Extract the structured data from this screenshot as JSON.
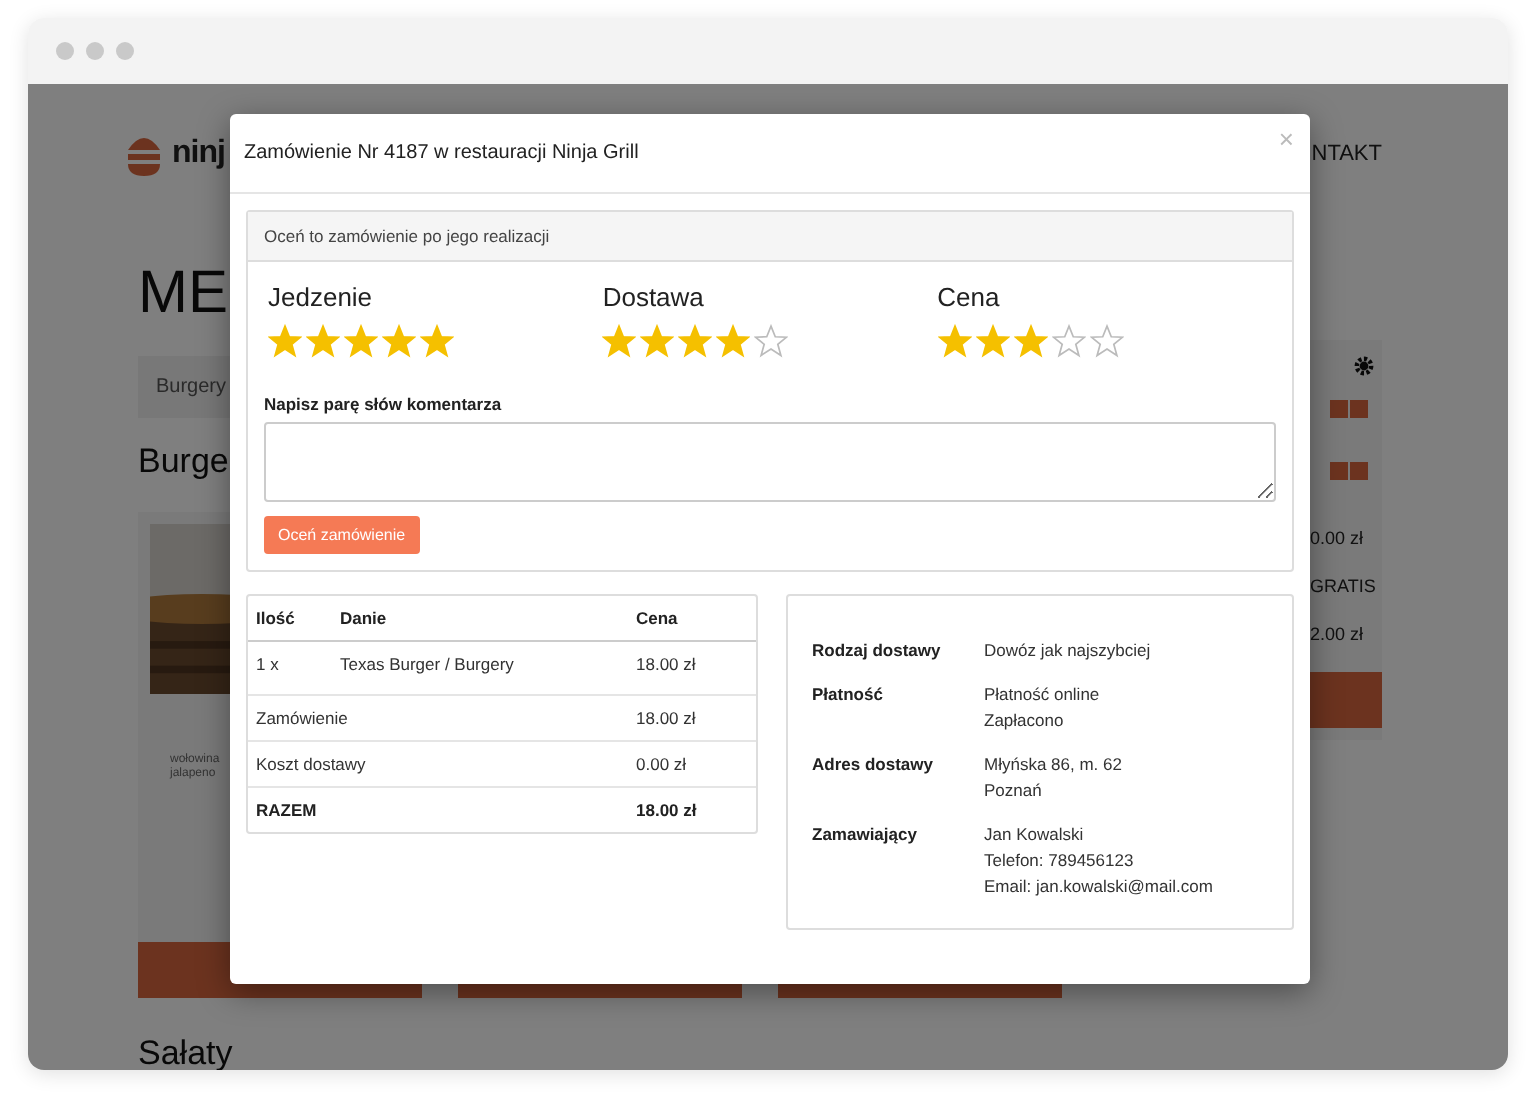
{
  "background_page": {
    "logo_text": "ninj",
    "nav_item": "NTAKT",
    "heading": "ME",
    "breadcrumb": "Burgery",
    "section_title": "Burge",
    "card_texts": [
      "wołowina",
      "jalapeno"
    ],
    "cart_rows": [
      "0.00 zł",
      "GRATIS",
      "2.00 zł"
    ],
    "next_section_title": "Sałaty"
  },
  "modal": {
    "title": "Zamówienie Nr 4187 w restauracji Ninja Grill",
    "close": "×",
    "rating": {
      "header": "Oceń to zamówienie po jego realizacji",
      "categories": [
        {
          "label": "Jedzenie",
          "stars": 5
        },
        {
          "label": "Dostawa",
          "stars": 4
        },
        {
          "label": "Cena",
          "stars": 3
        }
      ],
      "comment_label": "Napisz parę słów komentarza",
      "submit_button": "Oceń zamówienie"
    },
    "order_table": {
      "columns": [
        "Ilość",
        "Danie",
        "Cena"
      ],
      "rows": [
        {
          "qty": "1 x",
          "dish": "Texas Burger / Burgery",
          "price": "18.00 zł"
        }
      ],
      "summary": [
        {
          "label": "Zamówienie",
          "value": "18.00 zł",
          "kind": "normal"
        },
        {
          "label": "Koszt dostawy",
          "value": "0.00 zł",
          "kind": "normal"
        },
        {
          "label": "RAZEM",
          "value": "18.00 zł",
          "kind": "total"
        }
      ]
    },
    "details": [
      {
        "label": "Rodzaj dostawy",
        "lines": [
          "Dowóz jak najszybciej"
        ]
      },
      {
        "label": "Płatność",
        "lines": [
          "Płatność online",
          "Zapłacono"
        ]
      },
      {
        "label": "Adres dostawy",
        "lines": [
          "Młyńska 86, m. 62",
          "Poznań"
        ]
      },
      {
        "label": "Zamawiający",
        "lines": [
          "Jan Kowalski",
          "Telefon: 789456123",
          "Email: jan.kowalski@mail.com"
        ]
      }
    ]
  }
}
